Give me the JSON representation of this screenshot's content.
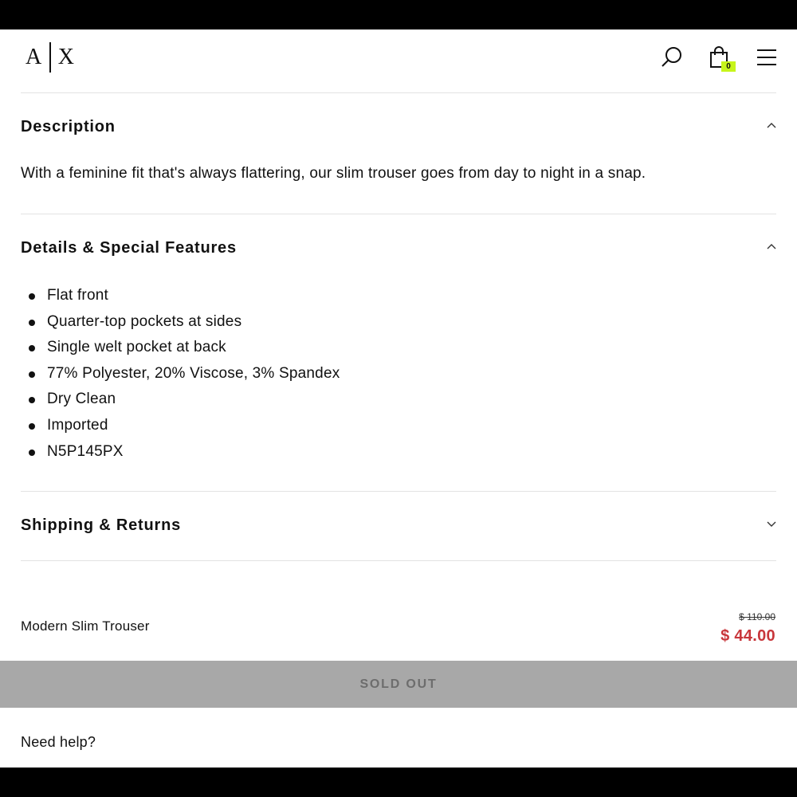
{
  "header": {
    "logo_left": "A",
    "logo_right": "X",
    "cart_count": "0",
    "badge_color": "#c7f51b"
  },
  "sections": {
    "description": {
      "title": "Description",
      "text": "With a feminine fit that's always flattering, our slim trouser goes from day to night in a snap.",
      "expanded": true
    },
    "details": {
      "title": "Details & Special Features",
      "expanded": true,
      "items": [
        "Flat front",
        "Quarter-top pockets at sides",
        "Single welt pocket at back",
        "77% Polyester, 20% Viscose, 3% Spandex",
        "Dry Clean",
        "Imported",
        "N5P145PX"
      ]
    },
    "shipping": {
      "title": "Shipping & Returns",
      "expanded": false
    }
  },
  "product": {
    "name": "Modern Slim Trouser",
    "original_price": "$ 110.00",
    "sale_price": "$ 44.00",
    "sale_color": "#c8363b"
  },
  "cta": {
    "label": "SOLD OUT"
  },
  "help": {
    "label": "Need help?"
  }
}
